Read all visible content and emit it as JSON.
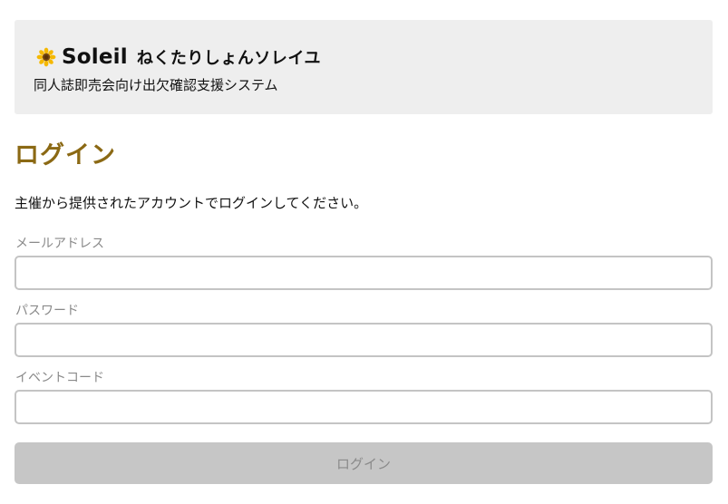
{
  "header": {
    "icon": "sunflower-icon",
    "brand_name": "Soleil",
    "brand_kana": "ねくたりしょんソレイユ",
    "tagline": "同人誌即売会向け出欠確認支援システム"
  },
  "main": {
    "title": "ログイン",
    "instruction": "主催から提供されたアカウントでログインしてください。",
    "fields": {
      "email": {
        "label": "メールアドレス",
        "value": ""
      },
      "password": {
        "label": "パスワード",
        "value": ""
      },
      "event_code": {
        "label": "イベントコード",
        "value": ""
      }
    },
    "login_button": "ログイン"
  },
  "colors": {
    "title": "#8b6914",
    "header_bg": "#eeeeee",
    "button_bg": "#c6c6c6",
    "label": "#8a8a8a"
  }
}
